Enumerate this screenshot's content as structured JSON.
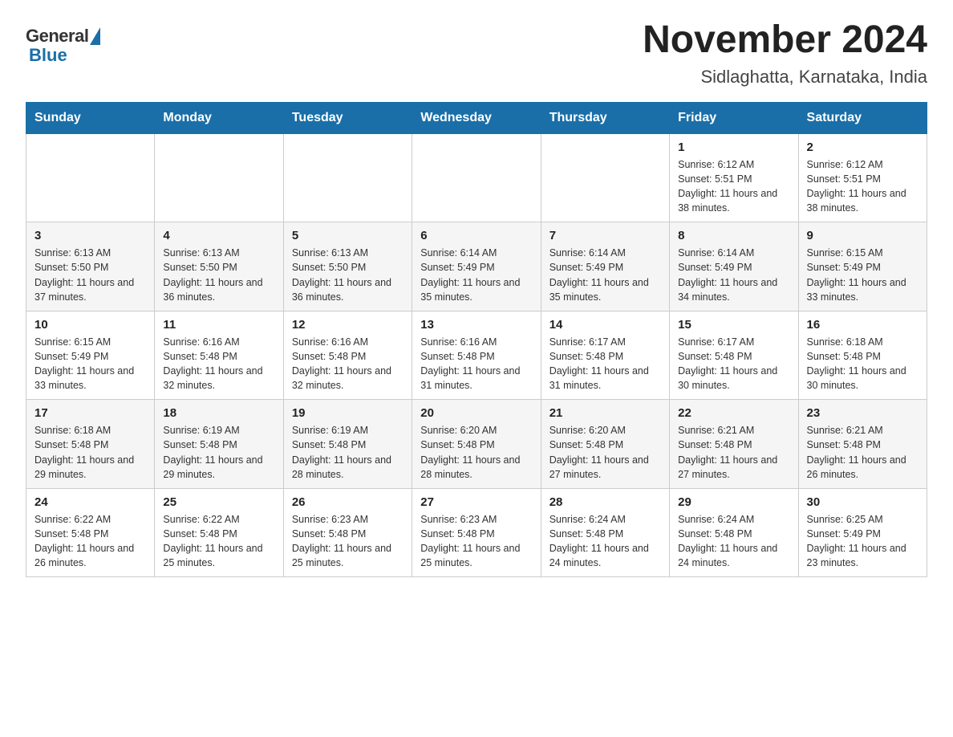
{
  "header": {
    "logo_general": "General",
    "logo_blue": "Blue",
    "month_title": "November 2024",
    "location": "Sidlaghatta, Karnataka, India"
  },
  "weekdays": [
    "Sunday",
    "Monday",
    "Tuesday",
    "Wednesday",
    "Thursday",
    "Friday",
    "Saturday"
  ],
  "weeks": [
    [
      {
        "day": "",
        "sunrise": "",
        "sunset": "",
        "daylight": ""
      },
      {
        "day": "",
        "sunrise": "",
        "sunset": "",
        "daylight": ""
      },
      {
        "day": "",
        "sunrise": "",
        "sunset": "",
        "daylight": ""
      },
      {
        "day": "",
        "sunrise": "",
        "sunset": "",
        "daylight": ""
      },
      {
        "day": "",
        "sunrise": "",
        "sunset": "",
        "daylight": ""
      },
      {
        "day": "1",
        "sunrise": "Sunrise: 6:12 AM",
        "sunset": "Sunset: 5:51 PM",
        "daylight": "Daylight: 11 hours and 38 minutes."
      },
      {
        "day": "2",
        "sunrise": "Sunrise: 6:12 AM",
        "sunset": "Sunset: 5:51 PM",
        "daylight": "Daylight: 11 hours and 38 minutes."
      }
    ],
    [
      {
        "day": "3",
        "sunrise": "Sunrise: 6:13 AM",
        "sunset": "Sunset: 5:50 PM",
        "daylight": "Daylight: 11 hours and 37 minutes."
      },
      {
        "day": "4",
        "sunrise": "Sunrise: 6:13 AM",
        "sunset": "Sunset: 5:50 PM",
        "daylight": "Daylight: 11 hours and 36 minutes."
      },
      {
        "day": "5",
        "sunrise": "Sunrise: 6:13 AM",
        "sunset": "Sunset: 5:50 PM",
        "daylight": "Daylight: 11 hours and 36 minutes."
      },
      {
        "day": "6",
        "sunrise": "Sunrise: 6:14 AM",
        "sunset": "Sunset: 5:49 PM",
        "daylight": "Daylight: 11 hours and 35 minutes."
      },
      {
        "day": "7",
        "sunrise": "Sunrise: 6:14 AM",
        "sunset": "Sunset: 5:49 PM",
        "daylight": "Daylight: 11 hours and 35 minutes."
      },
      {
        "day": "8",
        "sunrise": "Sunrise: 6:14 AM",
        "sunset": "Sunset: 5:49 PM",
        "daylight": "Daylight: 11 hours and 34 minutes."
      },
      {
        "day": "9",
        "sunrise": "Sunrise: 6:15 AM",
        "sunset": "Sunset: 5:49 PM",
        "daylight": "Daylight: 11 hours and 33 minutes."
      }
    ],
    [
      {
        "day": "10",
        "sunrise": "Sunrise: 6:15 AM",
        "sunset": "Sunset: 5:49 PM",
        "daylight": "Daylight: 11 hours and 33 minutes."
      },
      {
        "day": "11",
        "sunrise": "Sunrise: 6:16 AM",
        "sunset": "Sunset: 5:48 PM",
        "daylight": "Daylight: 11 hours and 32 minutes."
      },
      {
        "day": "12",
        "sunrise": "Sunrise: 6:16 AM",
        "sunset": "Sunset: 5:48 PM",
        "daylight": "Daylight: 11 hours and 32 minutes."
      },
      {
        "day": "13",
        "sunrise": "Sunrise: 6:16 AM",
        "sunset": "Sunset: 5:48 PM",
        "daylight": "Daylight: 11 hours and 31 minutes."
      },
      {
        "day": "14",
        "sunrise": "Sunrise: 6:17 AM",
        "sunset": "Sunset: 5:48 PM",
        "daylight": "Daylight: 11 hours and 31 minutes."
      },
      {
        "day": "15",
        "sunrise": "Sunrise: 6:17 AM",
        "sunset": "Sunset: 5:48 PM",
        "daylight": "Daylight: 11 hours and 30 minutes."
      },
      {
        "day": "16",
        "sunrise": "Sunrise: 6:18 AM",
        "sunset": "Sunset: 5:48 PM",
        "daylight": "Daylight: 11 hours and 30 minutes."
      }
    ],
    [
      {
        "day": "17",
        "sunrise": "Sunrise: 6:18 AM",
        "sunset": "Sunset: 5:48 PM",
        "daylight": "Daylight: 11 hours and 29 minutes."
      },
      {
        "day": "18",
        "sunrise": "Sunrise: 6:19 AM",
        "sunset": "Sunset: 5:48 PM",
        "daylight": "Daylight: 11 hours and 29 minutes."
      },
      {
        "day": "19",
        "sunrise": "Sunrise: 6:19 AM",
        "sunset": "Sunset: 5:48 PM",
        "daylight": "Daylight: 11 hours and 28 minutes."
      },
      {
        "day": "20",
        "sunrise": "Sunrise: 6:20 AM",
        "sunset": "Sunset: 5:48 PM",
        "daylight": "Daylight: 11 hours and 28 minutes."
      },
      {
        "day": "21",
        "sunrise": "Sunrise: 6:20 AM",
        "sunset": "Sunset: 5:48 PM",
        "daylight": "Daylight: 11 hours and 27 minutes."
      },
      {
        "day": "22",
        "sunrise": "Sunrise: 6:21 AM",
        "sunset": "Sunset: 5:48 PM",
        "daylight": "Daylight: 11 hours and 27 minutes."
      },
      {
        "day": "23",
        "sunrise": "Sunrise: 6:21 AM",
        "sunset": "Sunset: 5:48 PM",
        "daylight": "Daylight: 11 hours and 26 minutes."
      }
    ],
    [
      {
        "day": "24",
        "sunrise": "Sunrise: 6:22 AM",
        "sunset": "Sunset: 5:48 PM",
        "daylight": "Daylight: 11 hours and 26 minutes."
      },
      {
        "day": "25",
        "sunrise": "Sunrise: 6:22 AM",
        "sunset": "Sunset: 5:48 PM",
        "daylight": "Daylight: 11 hours and 25 minutes."
      },
      {
        "day": "26",
        "sunrise": "Sunrise: 6:23 AM",
        "sunset": "Sunset: 5:48 PM",
        "daylight": "Daylight: 11 hours and 25 minutes."
      },
      {
        "day": "27",
        "sunrise": "Sunrise: 6:23 AM",
        "sunset": "Sunset: 5:48 PM",
        "daylight": "Daylight: 11 hours and 25 minutes."
      },
      {
        "day": "28",
        "sunrise": "Sunrise: 6:24 AM",
        "sunset": "Sunset: 5:48 PM",
        "daylight": "Daylight: 11 hours and 24 minutes."
      },
      {
        "day": "29",
        "sunrise": "Sunrise: 6:24 AM",
        "sunset": "Sunset: 5:48 PM",
        "daylight": "Daylight: 11 hours and 24 minutes."
      },
      {
        "day": "30",
        "sunrise": "Sunrise: 6:25 AM",
        "sunset": "Sunset: 5:49 PM",
        "daylight": "Daylight: 11 hours and 23 minutes."
      }
    ]
  ]
}
